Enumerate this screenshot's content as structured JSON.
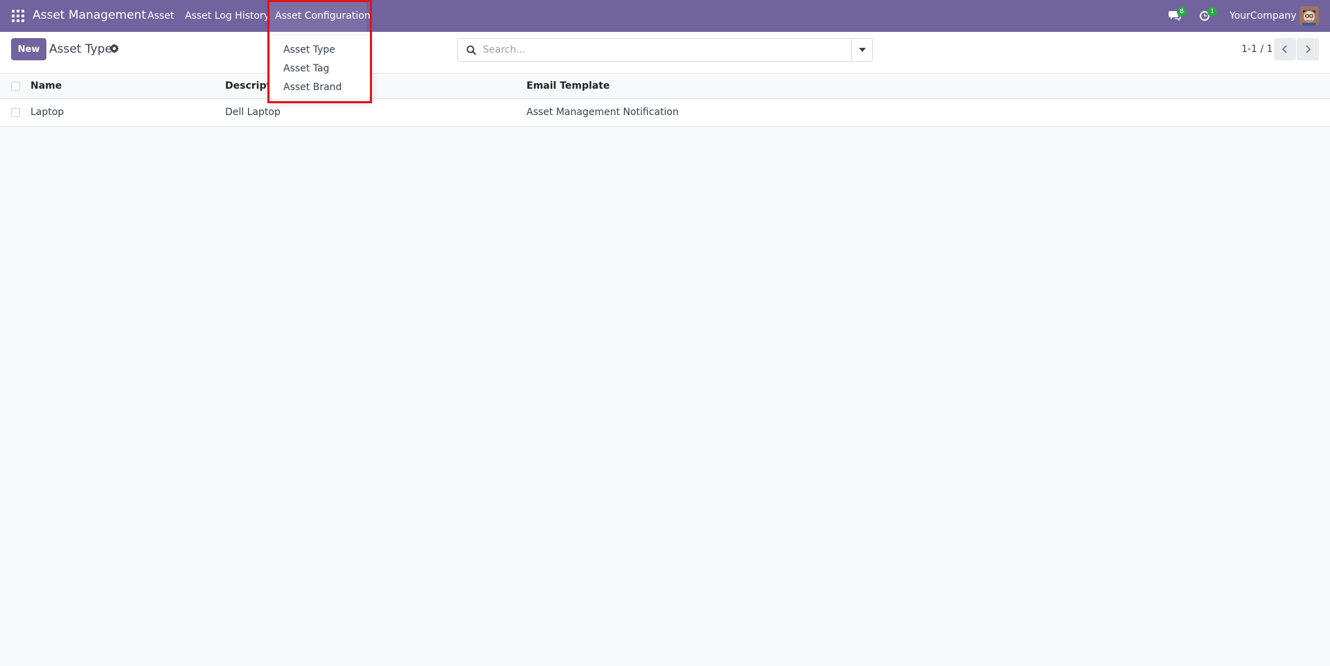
{
  "navbar": {
    "app_title": "Asset Management",
    "menu": [
      {
        "label": "Asset"
      },
      {
        "label": "Asset Log History"
      },
      {
        "label": "Asset Configuration"
      }
    ],
    "messages_count": "8",
    "activities_count": "1",
    "company": "YourCompany"
  },
  "dropdown": {
    "items": [
      {
        "label": "Asset Type"
      },
      {
        "label": "Asset Tag"
      },
      {
        "label": "Asset Brand"
      }
    ]
  },
  "control_panel": {
    "new_label": "New",
    "title": "Asset Type",
    "search_placeholder": "Search...",
    "pager": "1-1 / 1"
  },
  "table": {
    "columns": [
      "Name",
      "Description",
      "Email Template"
    ],
    "rows": [
      {
        "name": "Laptop",
        "description": "Dell Laptop",
        "email_template": "Asset Management Notification"
      }
    ]
  },
  "colors": {
    "navbar": "#71639e",
    "primary_button": "#71639e",
    "badge": "#28a745",
    "highlight": "#e0121b"
  }
}
